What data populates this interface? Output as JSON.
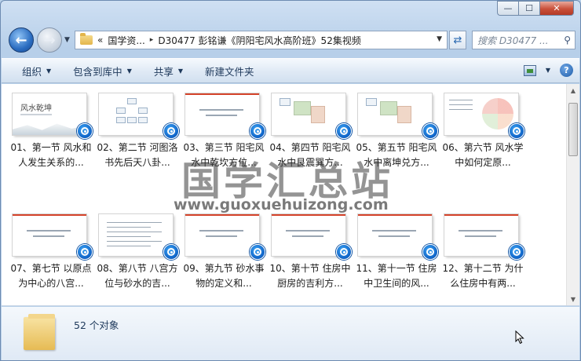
{
  "window": {
    "caption": {
      "minimize": "—",
      "maximize": "☐",
      "close": "✕"
    }
  },
  "nav": {
    "address": {
      "chevron": "«",
      "crumbs": [
        "国学资...",
        "D30477 彭铭谦《阴阳宅风水高阶班》52集视频"
      ],
      "separator": "▸"
    },
    "search_placeholder": "搜索 D30477 ..."
  },
  "toolbar": {
    "organize": "组织",
    "include_library": "包含到库中",
    "share": "共享",
    "new_folder": "新建文件夹"
  },
  "items": [
    {
      "name": "01、第一节 风水和人发生关系的...",
      "thumb": "title"
    },
    {
      "name": "02、第二节 河图洛书先后天八卦...",
      "thumb": "grid"
    },
    {
      "name": "03、第三节 阳宅风水中乾坎方位...",
      "thumb": "text"
    },
    {
      "name": "04、第四节 阳宅风水中艮震巽方...",
      "thumb": "plan"
    },
    {
      "name": "05、第五节 阳宅风水中离坤兑方...",
      "thumb": "plan"
    },
    {
      "name": "06、第六节 风水学中如何定原...",
      "thumb": "fan"
    },
    {
      "name": "07、第七节 以原点为中心的八宫...",
      "thumb": "slide"
    },
    {
      "name": "08、第八节 八宫方位与砂水的吉...",
      "thumb": "doc"
    },
    {
      "name": "09、第九节 砂水事物的定义和...",
      "thumb": "slide"
    },
    {
      "name": "10、第十节 住房中厨房的吉利方...",
      "thumb": "slide"
    },
    {
      "name": "11、第十一节 住房中卫生间的风...",
      "thumb": "slide"
    },
    {
      "name": "12、第十二节 为什么住房中有两...",
      "thumb": "slide"
    }
  ],
  "thumb_text": {
    "title_main": "风水乾坤"
  },
  "watermark": {
    "cn": "国学汇总站",
    "url": "www.guoxuehuizong.com"
  },
  "details": {
    "count": "52 个对象"
  },
  "colors": {
    "accent": "#0f63c7",
    "toolbar_text": "#1e395b"
  }
}
